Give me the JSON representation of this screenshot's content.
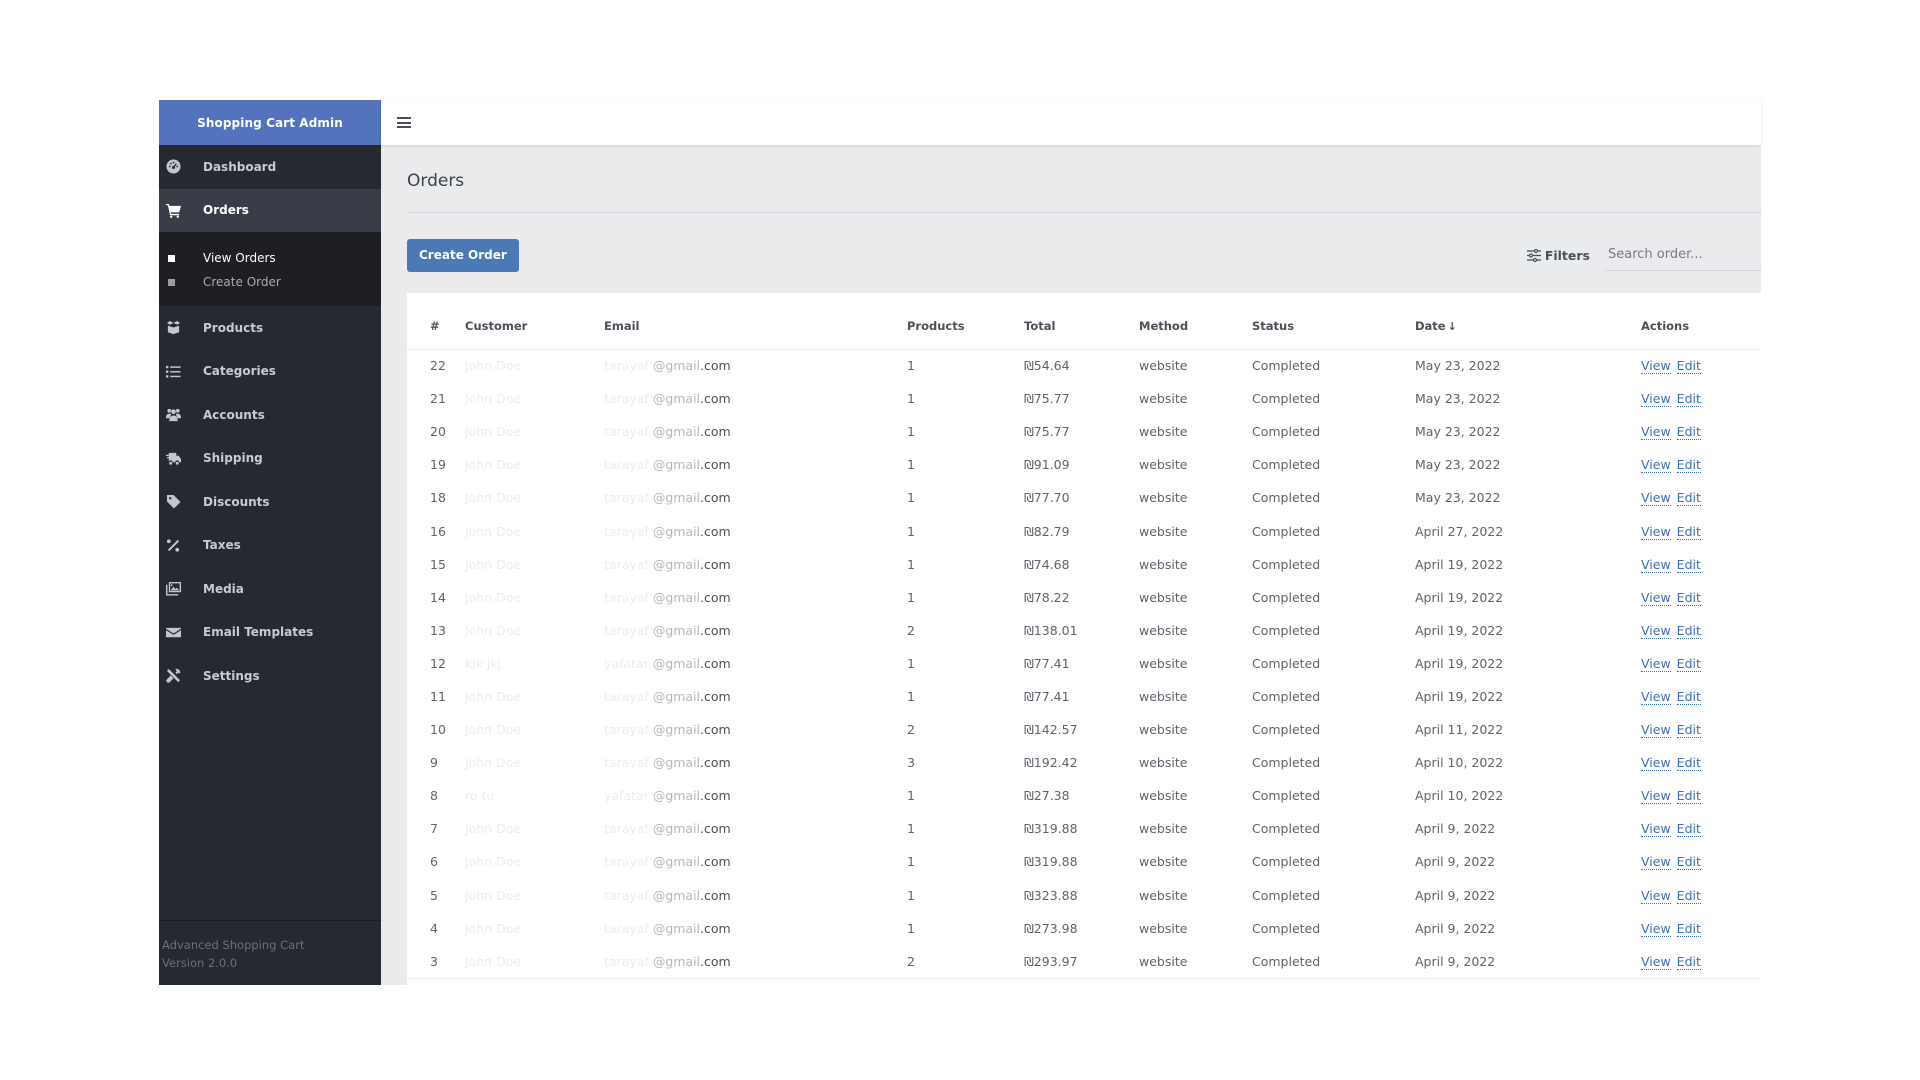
{
  "app": {
    "title": "Shopping Cart Admin"
  },
  "sidebar": {
    "items": [
      {
        "label": "Dashboard",
        "icon": "dashboard-icon"
      },
      {
        "label": "Orders",
        "icon": "cart-icon",
        "active": true
      },
      {
        "label": "Products",
        "icon": "box-icon"
      },
      {
        "label": "Categories",
        "icon": "list-icon"
      },
      {
        "label": "Accounts",
        "icon": "users-icon"
      },
      {
        "label": "Shipping",
        "icon": "truck-icon"
      },
      {
        "label": "Discounts",
        "icon": "tag-icon"
      },
      {
        "label": "Taxes",
        "icon": "percent-icon"
      },
      {
        "label": "Media",
        "icon": "images-icon"
      },
      {
        "label": "Email Templates",
        "icon": "envelope-icon"
      },
      {
        "label": "Settings",
        "icon": "tools-icon"
      }
    ],
    "orders_submenu": [
      {
        "label": "View Orders",
        "active": true
      },
      {
        "label": "Create Order"
      }
    ],
    "footer": {
      "product": "Advanced Shopping Cart",
      "version": "Version 2.0.0"
    }
  },
  "colors": {
    "brand": "#5373bd",
    "sidebar_bg": "#262930",
    "primary_button": "#4a79b6",
    "link": "#3d6fb6",
    "page_bg": "#eaebed"
  },
  "page": {
    "title": "Orders",
    "create_button": "Create Order",
    "filters_label": "Filters",
    "search_placeholder": "Search order..."
  },
  "table": {
    "columns": [
      "#",
      "Customer",
      "Email",
      "Products",
      "Total",
      "Method",
      "Status",
      "Date",
      "Actions"
    ],
    "sort_indicator": "↓",
    "action_labels": {
      "view": "View",
      "edit": "Edit"
    },
    "email_domain_parts": {
      "at": "@gmail",
      "tld": ".com"
    },
    "rows": [
      {
        "id": "22",
        "customer": "John Doe",
        "email_user": "tarayaf",
        "products": "1",
        "total": "₪54.64",
        "method": "website",
        "status": "Completed",
        "date": "May 23, 2022"
      },
      {
        "id": "21",
        "customer": "John Doe",
        "email_user": "tarayaf",
        "products": "1",
        "total": "₪75.77",
        "method": "website",
        "status": "Completed",
        "date": "May 23, 2022"
      },
      {
        "id": "20",
        "customer": "John Doe",
        "email_user": "tarayaf",
        "products": "1",
        "total": "₪75.77",
        "method": "website",
        "status": "Completed",
        "date": "May 23, 2022"
      },
      {
        "id": "19",
        "customer": "John Doe",
        "email_user": "tarayaf",
        "products": "1",
        "total": "₪91.09",
        "method": "website",
        "status": "Completed",
        "date": "May 23, 2022"
      },
      {
        "id": "18",
        "customer": "John Doe",
        "email_user": "tarayaf",
        "products": "1",
        "total": "₪77.70",
        "method": "website",
        "status": "Completed",
        "date": "May 23, 2022"
      },
      {
        "id": "16",
        "customer": "John Doe",
        "email_user": "tarayaf",
        "products": "1",
        "total": "₪82.79",
        "method": "website",
        "status": "Completed",
        "date": "April 27, 2022"
      },
      {
        "id": "15",
        "customer": "John Doe",
        "email_user": "tarayaf",
        "products": "1",
        "total": "₪74.68",
        "method": "website",
        "status": "Completed",
        "date": "April 19, 2022"
      },
      {
        "id": "14",
        "customer": "John Doe",
        "email_user": "tarayaf",
        "products": "1",
        "total": "₪78.22",
        "method": "website",
        "status": "Completed",
        "date": "April 19, 2022"
      },
      {
        "id": "13",
        "customer": "John Doe",
        "email_user": "tarayaf",
        "products": "2",
        "total": "₪138.01",
        "method": "website",
        "status": "Completed",
        "date": "April 19, 2022"
      },
      {
        "id": "12",
        "customer": "kjk jkj",
        "email_user": "yafatar",
        "products": "1",
        "total": "₪77.41",
        "method": "website",
        "status": "Completed",
        "date": "April 19, 2022"
      },
      {
        "id": "11",
        "customer": "John Doe",
        "email_user": "tarayaf",
        "products": "1",
        "total": "₪77.41",
        "method": "website",
        "status": "Completed",
        "date": "April 19, 2022"
      },
      {
        "id": "10",
        "customer": "John Doe",
        "email_user": "tarayaf",
        "products": "2",
        "total": "₪142.57",
        "method": "website",
        "status": "Completed",
        "date": "April 11, 2022"
      },
      {
        "id": "9",
        "customer": "John Doe",
        "email_user": "tarayaf",
        "products": "3",
        "total": "₪192.42",
        "method": "website",
        "status": "Completed",
        "date": "April 10, 2022"
      },
      {
        "id": "8",
        "customer": "ro tu",
        "email_user": "yafatar",
        "products": "1",
        "total": "₪27.38",
        "method": "website",
        "status": "Completed",
        "date": "April 10, 2022"
      },
      {
        "id": "7",
        "customer": "John Doe",
        "email_user": "tarayaf",
        "products": "1",
        "total": "₪319.88",
        "method": "website",
        "status": "Completed",
        "date": "April 9, 2022"
      },
      {
        "id": "6",
        "customer": "John Doe",
        "email_user": "tarayaf",
        "products": "1",
        "total": "₪319.88",
        "method": "website",
        "status": "Completed",
        "date": "April 9, 2022"
      },
      {
        "id": "5",
        "customer": "John Doe",
        "email_user": "tarayaf",
        "products": "1",
        "total": "₪323.88",
        "method": "website",
        "status": "Completed",
        "date": "April 9, 2022"
      },
      {
        "id": "4",
        "customer": "John Doe",
        "email_user": "tarayaf",
        "products": "1",
        "total": "₪273.98",
        "method": "website",
        "status": "Completed",
        "date": "April 9, 2022"
      },
      {
        "id": "3",
        "customer": "John Doe",
        "email_user": "tarayaf",
        "products": "2",
        "total": "₪293.97",
        "method": "website",
        "status": "Completed",
        "date": "April 9, 2022"
      }
    ]
  }
}
